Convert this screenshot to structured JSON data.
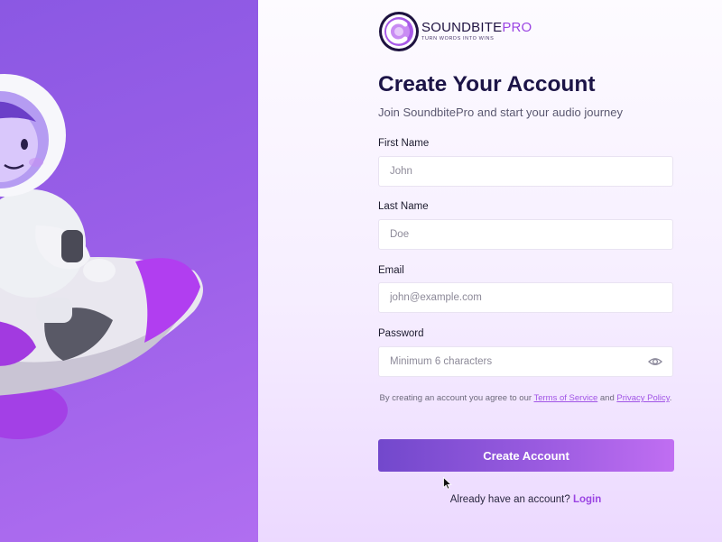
{
  "brand": {
    "name_main": "SOUNDBITE",
    "name_accent": "PRO",
    "tagline": "TURN WORDS INTO WINS",
    "logo_icon": "logo-c-icon"
  },
  "form": {
    "title": "Create Your Account",
    "subtitle": "Join SoundbitePro and start your audio journey",
    "first_name": {
      "label": "First Name",
      "placeholder": "John",
      "value": ""
    },
    "last_name": {
      "label": "Last Name",
      "placeholder": "Doe",
      "value": ""
    },
    "email": {
      "label": "Email",
      "placeholder": "john@example.com",
      "value": ""
    },
    "password": {
      "label": "Password",
      "placeholder": "Minimum 6 characters",
      "value": "",
      "toggle_icon": "eye-icon"
    },
    "terms": {
      "prefix": "By creating an account you agree to our ",
      "tos_link": "Terms of Service",
      "middle": " and ",
      "privacy_link": "Privacy Policy",
      "suffix": "."
    },
    "submit_label": "Create Account",
    "login_prompt": "Already have an account? ",
    "login_link": "Login"
  },
  "hero": {
    "illustration": "astronaut-on-rocket-illustration"
  },
  "colors": {
    "accent": "#9b45e3",
    "heading": "#1c1447",
    "hero_bg": "#9a5fe8"
  }
}
